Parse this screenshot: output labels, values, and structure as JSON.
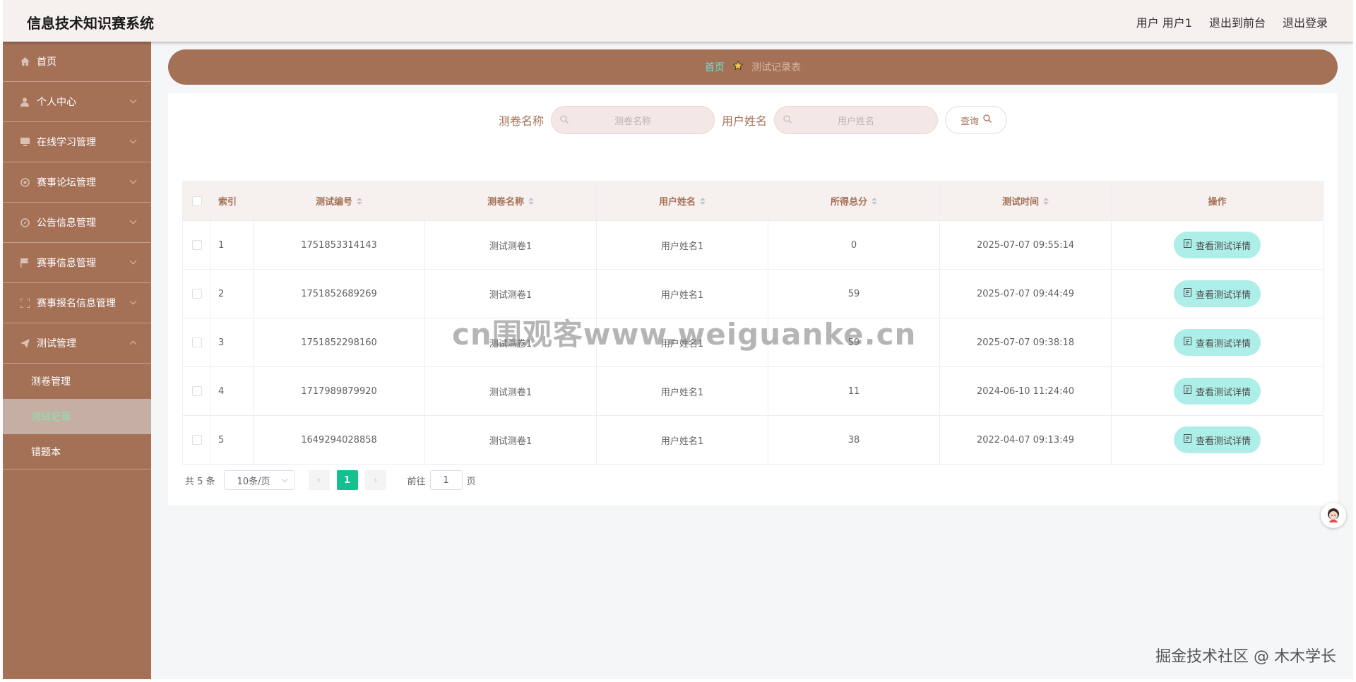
{
  "app": {
    "title": "信息技术知识赛系统"
  },
  "header": {
    "user_label": "用户 用户1",
    "front_link": "退出到前台",
    "logout_link": "退出登录"
  },
  "sidebar": {
    "items": [
      {
        "label": "首页",
        "icon": "home-icon"
      },
      {
        "label": "个人中心",
        "icon": "user-icon"
      },
      {
        "label": "在线学习管理",
        "icon": "monitor-icon"
      },
      {
        "label": "赛事论坛管理",
        "icon": "forum-icon"
      },
      {
        "label": "公告信息管理",
        "icon": "compass-icon"
      },
      {
        "label": "赛事信息管理",
        "icon": "flag-icon"
      },
      {
        "label": "赛事报名信息管理",
        "icon": "scan-icon"
      },
      {
        "label": "测试管理",
        "icon": "send-icon"
      }
    ],
    "sub_items": [
      {
        "label": "测卷管理"
      },
      {
        "label": "测试记录"
      },
      {
        "label": "错题本"
      }
    ]
  },
  "breadcrumb": {
    "home": "首页",
    "current": "测试记录表"
  },
  "search": {
    "label_paper": "测卷名称",
    "placeholder_paper": "测卷名称",
    "label_user": "用户姓名",
    "placeholder_user": "用户姓名",
    "query_button": "查询"
  },
  "table": {
    "headers": [
      "索引",
      "测试编号",
      "测卷名称",
      "用户姓名",
      "所得总分",
      "测试时间",
      "操作"
    ],
    "action_label": "查看测试详情",
    "rows": [
      [
        "1",
        "1751853314143",
        "测试测卷1",
        "用户姓名1",
        "0",
        "2025-07-07 09:55:14"
      ],
      [
        "2",
        "1751852689269",
        "测试测卷1",
        "用户姓名1",
        "59",
        "2025-07-07 09:44:49"
      ],
      [
        "3",
        "1751852298160",
        "测试测卷1",
        "用户姓名1",
        "59",
        "2025-07-07 09:38:18"
      ],
      [
        "4",
        "1717989879920",
        "测试测卷1",
        "用户姓名1",
        "11",
        "2024-06-10 11:24:40"
      ],
      [
        "5",
        "1649294028858",
        "测试测卷1",
        "用户姓名1",
        "38",
        "2022-04-07 09:13:49"
      ]
    ]
  },
  "pagination": {
    "total": "共 5 条",
    "page_size": "10条/页",
    "current_page": "1",
    "goto_prefix": "前往",
    "goto_value": "1",
    "goto_suffix": "页"
  },
  "watermarks": {
    "center": "cn围观客www.weiguanke.cn",
    "corner": "掘金技术社区 @ 木木学长"
  },
  "colors": {
    "brand": "#a47157",
    "header_bg": "#f6f0ef",
    "accent_teal": "#aeeee8",
    "pager_active": "#13c08e"
  }
}
